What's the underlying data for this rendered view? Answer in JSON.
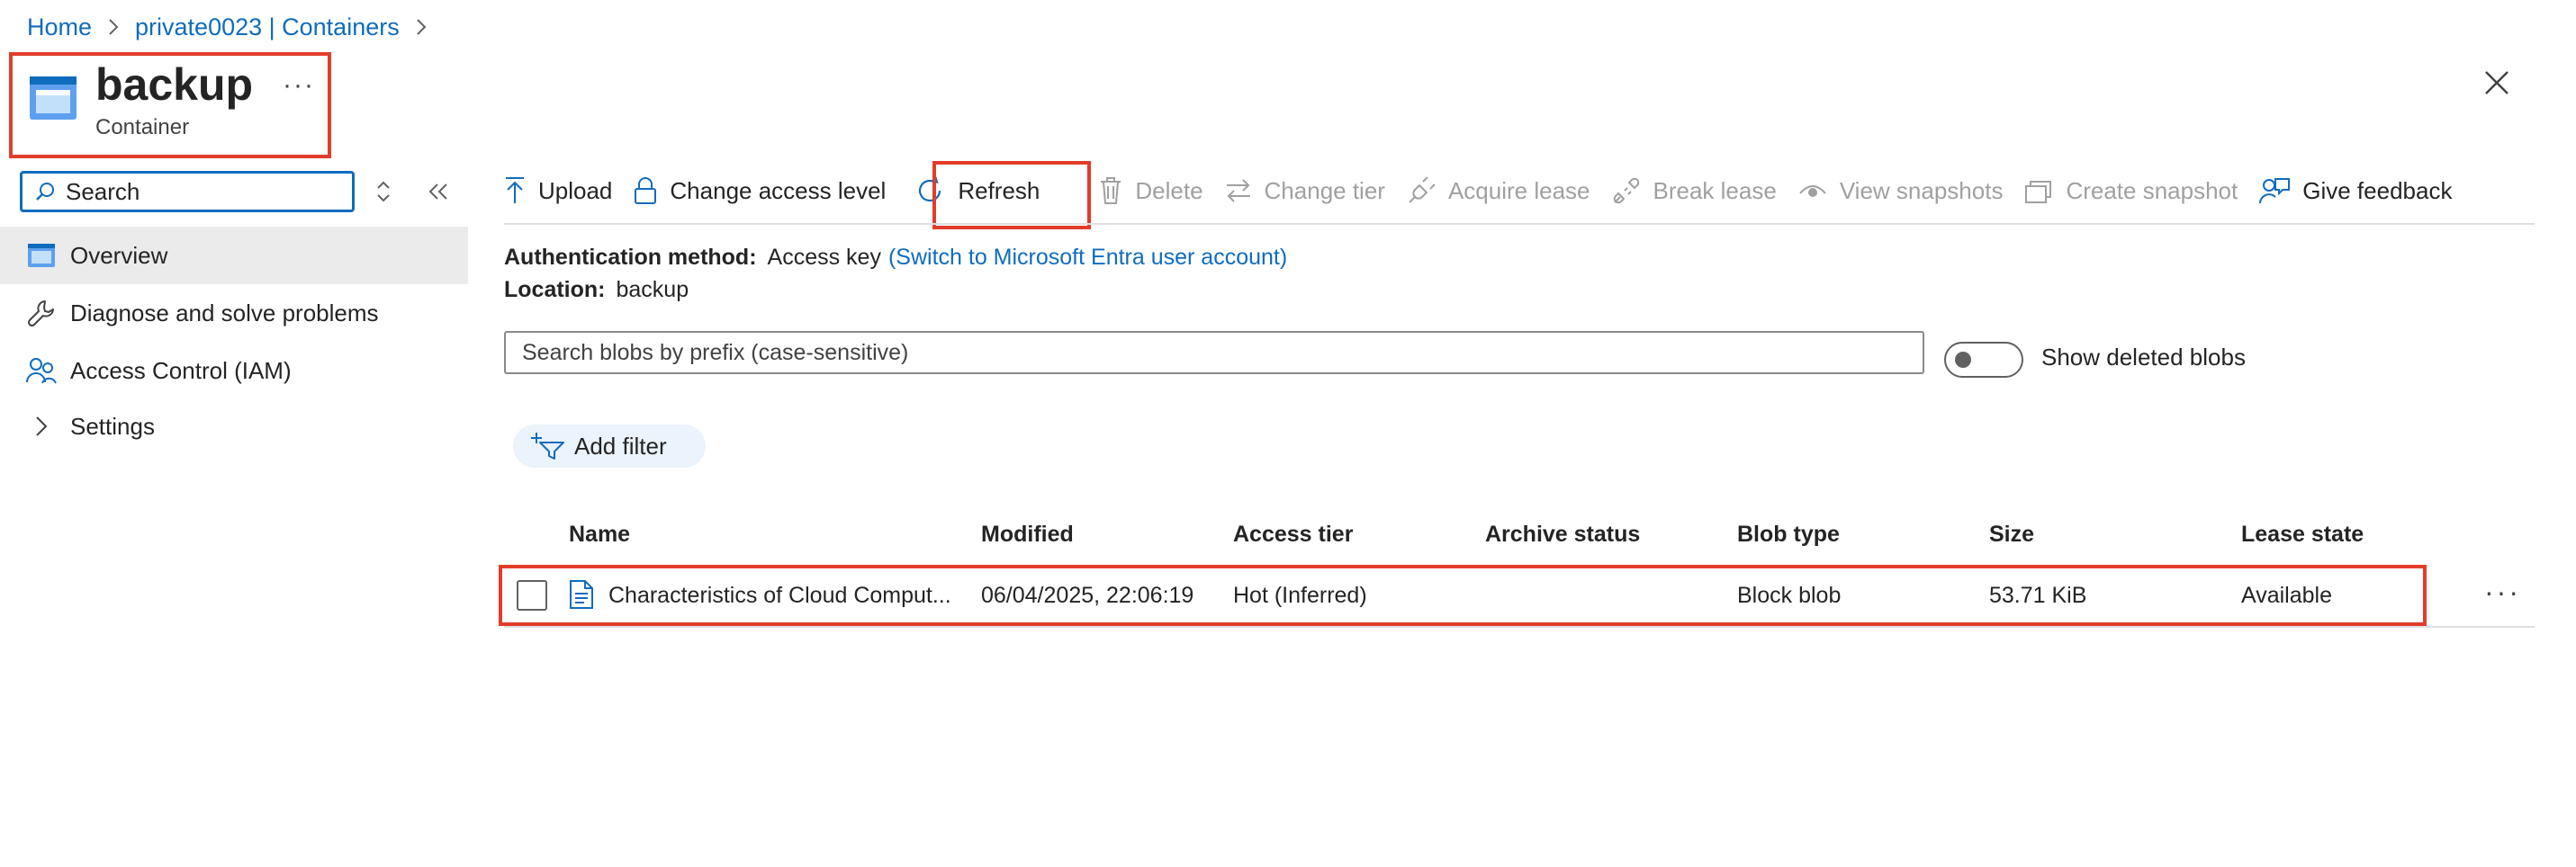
{
  "breadcrumb": {
    "home": "Home",
    "parent": "private0023 | Containers"
  },
  "header": {
    "title": "backup",
    "subtitle": "Container",
    "more": "···"
  },
  "nav": {
    "search_placeholder": "Search",
    "items": [
      {
        "label": "Overview",
        "icon": "container-icon",
        "active": true
      },
      {
        "label": "Diagnose and solve problems",
        "icon": "wrench-icon"
      },
      {
        "label": "Access Control (IAM)",
        "icon": "people-icon"
      },
      {
        "label": "Settings",
        "icon": "chevron-right-icon"
      }
    ]
  },
  "toolbar": {
    "upload": "Upload",
    "change_access": "Change access level",
    "refresh": "Refresh",
    "delete": "Delete",
    "change_tier": "Change tier",
    "acquire_lease": "Acquire lease",
    "break_lease": "Break lease",
    "view_snapshots": "View snapshots",
    "create_snapshot": "Create snapshot",
    "give_feedback": "Give feedback"
  },
  "info": {
    "auth_label": "Authentication method:",
    "auth_value": "Access key",
    "auth_link": "(Switch to Microsoft Entra user account)",
    "location_label": "Location:",
    "location_value": "backup"
  },
  "blob_search": {
    "placeholder": "Search blobs by prefix (case-sensitive)"
  },
  "show_deleted": {
    "label": "Show deleted blobs",
    "enabled": false
  },
  "add_filter": "Add filter",
  "table": {
    "columns": [
      "Name",
      "Modified",
      "Access tier",
      "Archive status",
      "Blob type",
      "Size",
      "Lease state"
    ],
    "rows": [
      {
        "name": "Characteristics of Cloud Comput...",
        "modified": "06/04/2025, 22:06:19",
        "access_tier": "Hot (Inferred)",
        "archive_status": "",
        "blob_type": "Block blob",
        "size": "53.71 KiB",
        "lease_state": "Available"
      }
    ],
    "row_more": "···"
  },
  "colors": {
    "accent": "#0f6cbd",
    "highlight": "#e23c2a",
    "disabled": "#a0a0a0"
  }
}
